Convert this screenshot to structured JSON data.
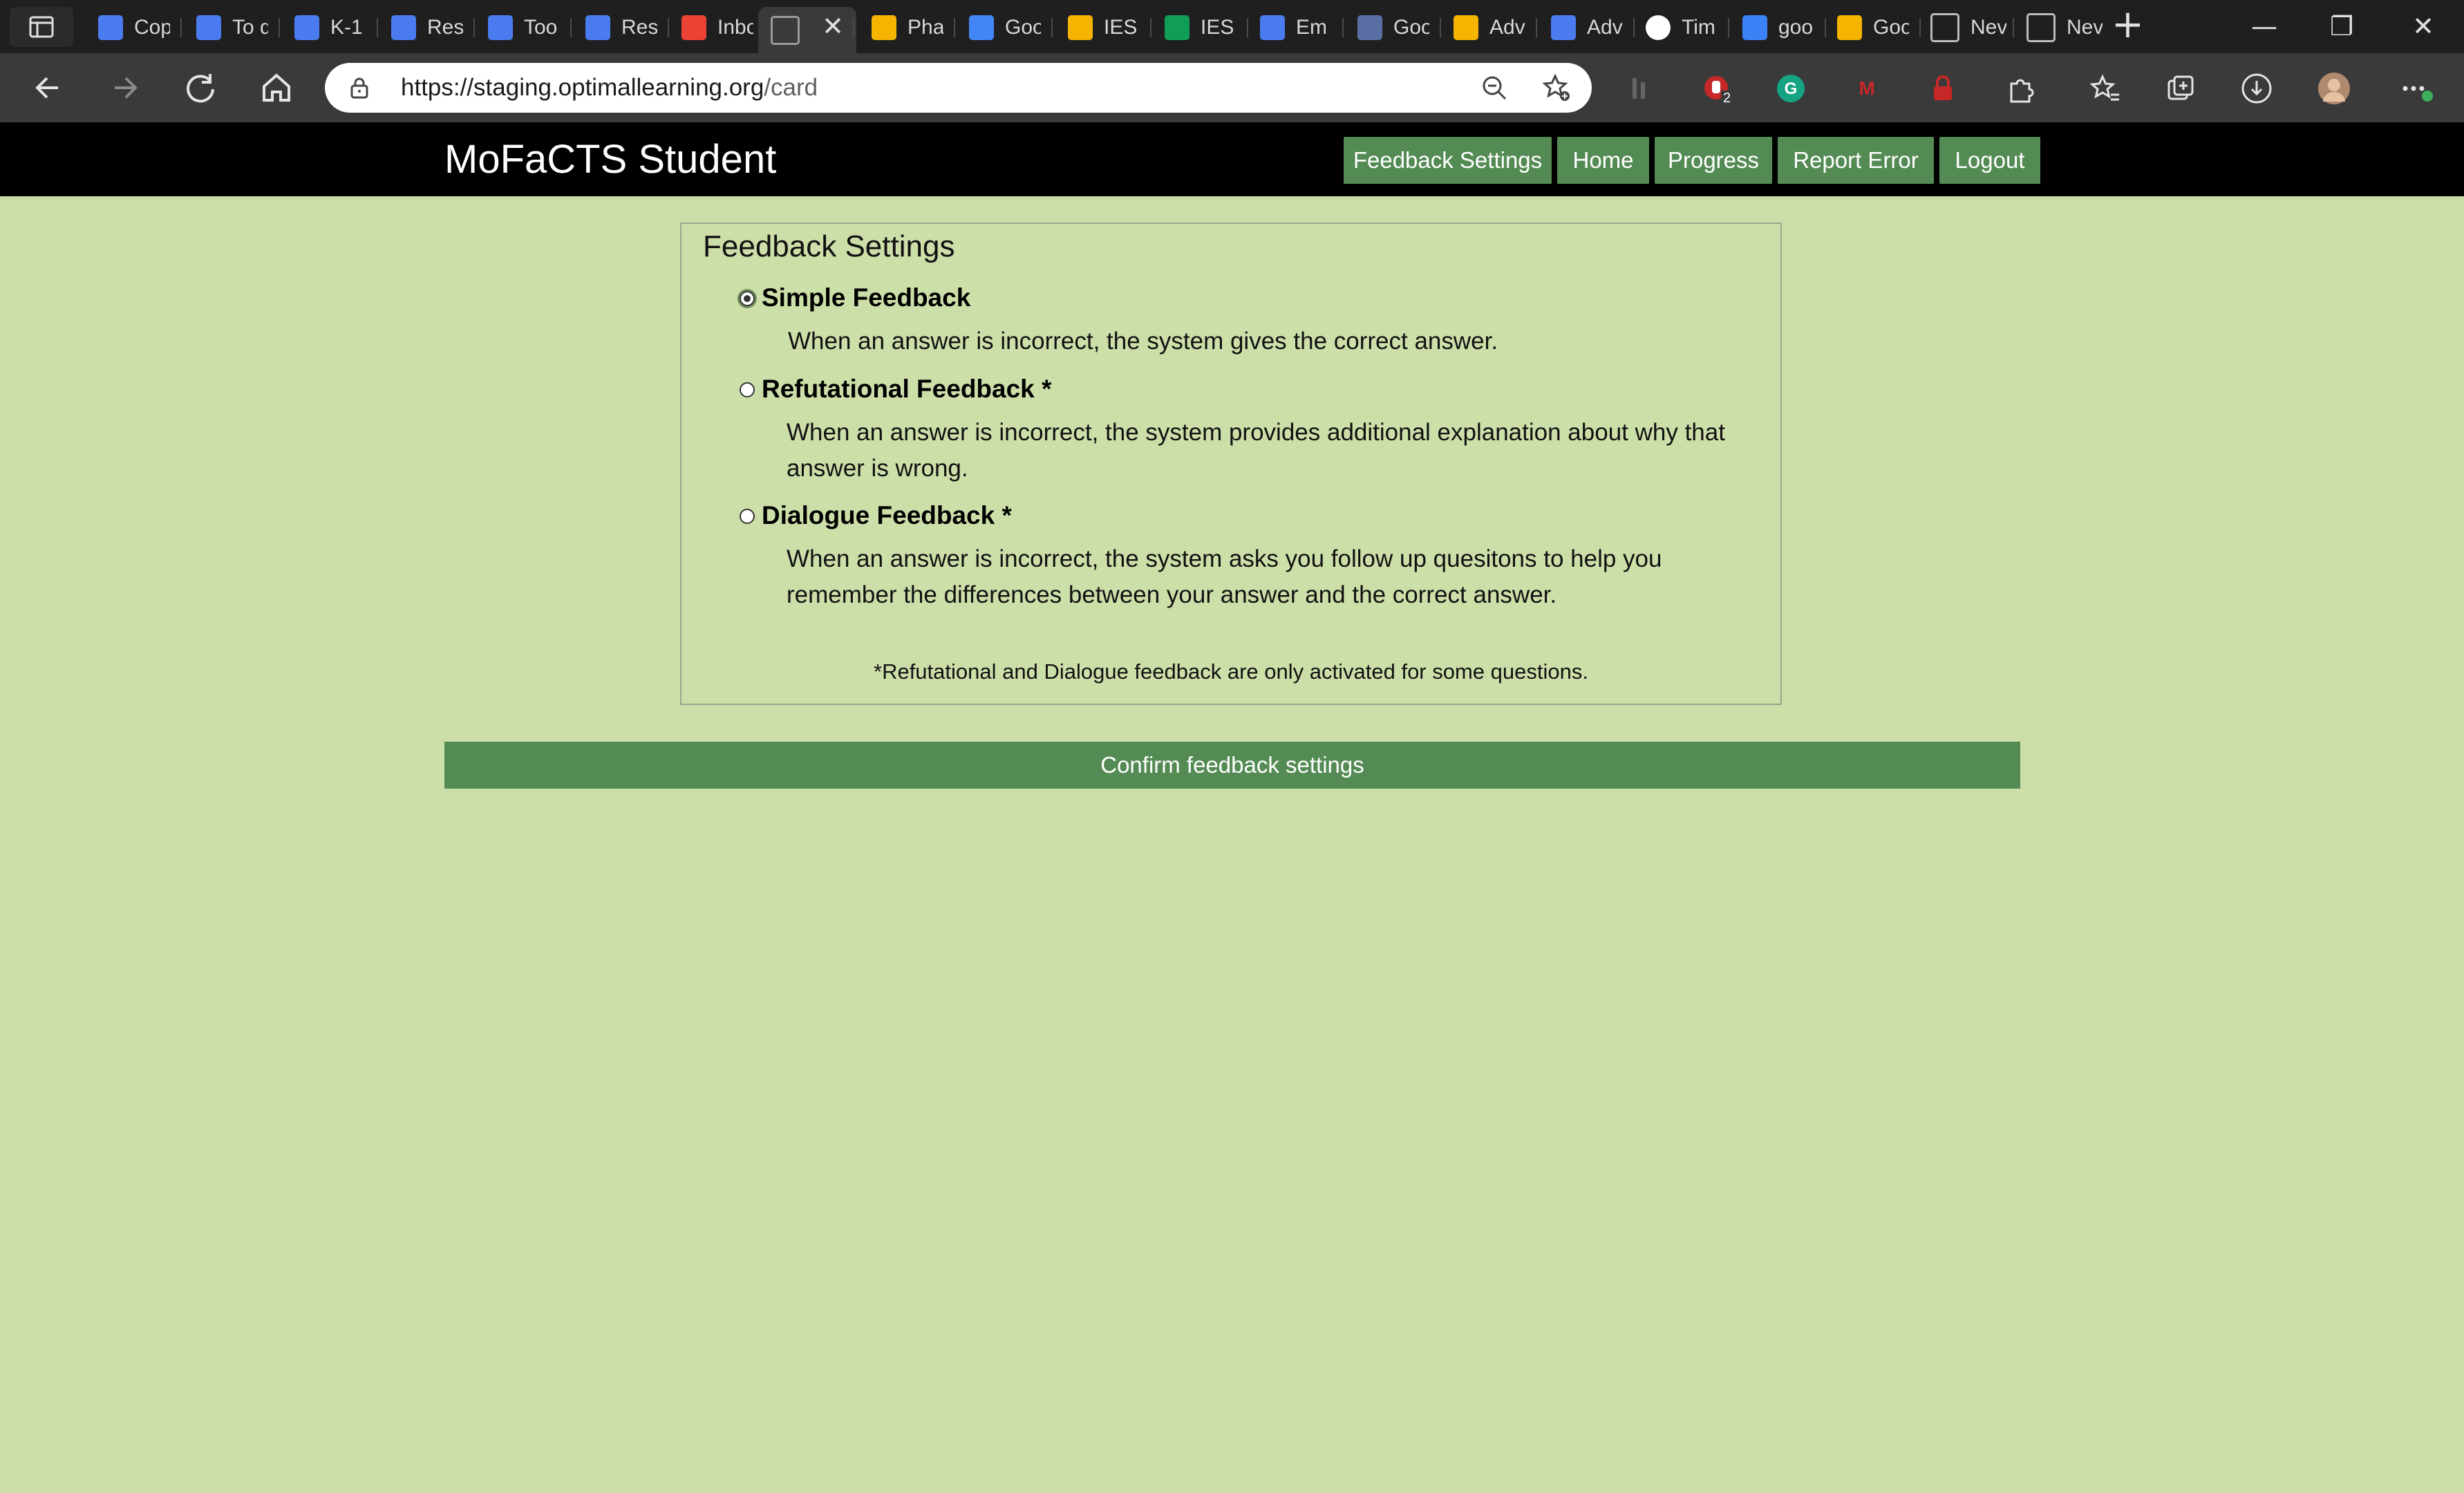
{
  "browser": {
    "tabs": [
      {
        "title": "Cop",
        "icon": "docs-icon",
        "color": "#4a7cf0"
      },
      {
        "title": "To d",
        "icon": "docs-icon",
        "color": "#4a7cf0"
      },
      {
        "title": "K-1",
        "icon": "docs-icon",
        "color": "#4a7cf0"
      },
      {
        "title": "Res",
        "icon": "docs-icon",
        "color": "#4a7cf0"
      },
      {
        "title": "Too",
        "icon": "docs-icon",
        "color": "#4a7cf0"
      },
      {
        "title": "Res",
        "icon": "docs-icon",
        "color": "#4a7cf0"
      },
      {
        "title": "Inbo",
        "icon": "gmail-icon",
        "color": "#ea4335"
      },
      {
        "title": "",
        "icon": "page-icon",
        "color": "#9a9a9a"
      },
      {
        "title": "Pha",
        "icon": "drive-icon",
        "color": "#f4b400"
      },
      {
        "title": "Goo",
        "icon": "calendar-icon",
        "color": "#4285f4"
      },
      {
        "title": "IES",
        "icon": "drive-icon",
        "color": "#f4b400"
      },
      {
        "title": "IES",
        "icon": "sheets-icon",
        "color": "#0f9d58"
      },
      {
        "title": "Em",
        "icon": "docs-icon",
        "color": "#4a7cf0"
      },
      {
        "title": "Goo",
        "icon": "classroom-icon",
        "color": "#5a6fa3"
      },
      {
        "title": "Adv",
        "icon": "drive-icon",
        "color": "#f4b400"
      },
      {
        "title": "Adv",
        "icon": "docs-icon",
        "color": "#4a7cf0"
      },
      {
        "title": "Tim",
        "icon": "github-icon",
        "color": "#ffffff"
      },
      {
        "title": "goo",
        "icon": "bing-icon",
        "color": "#3b82f6"
      },
      {
        "title": "Goo",
        "icon": "slides-icon",
        "color": "#f4b400"
      },
      {
        "title": "Nev",
        "icon": "newtab-icon",
        "color": "#bbbbbb"
      },
      {
        "title": "Nev",
        "icon": "newtab-icon",
        "color": "#bbbbbb"
      }
    ],
    "new_tab_glyph": "+",
    "window_controls": {
      "minimize": "—",
      "restore": "❐",
      "close": "✕"
    },
    "address": {
      "url_host": "https://staging.optimallearning.org",
      "url_path": "/card"
    },
    "extensions": [
      {
        "name": "extension-bars-icon",
        "badge": ""
      },
      {
        "name": "adblock-extension-icon",
        "badge": "2"
      },
      {
        "name": "grammarly-extension-icon",
        "badge": ""
      },
      {
        "name": "mcafee-extension-icon",
        "badge": ""
      },
      {
        "name": "lock-extension-icon",
        "badge": ""
      },
      {
        "name": "extensions-puzzle-icon",
        "badge": ""
      }
    ]
  },
  "navbar": {
    "brand": "MoFaCTS Student",
    "links": [
      "Feedback Settings",
      "Home",
      "Progress",
      "Report Error",
      "Logout"
    ]
  },
  "feedback": {
    "title": "Feedback Settings",
    "options": [
      {
        "label": "Simple Feedback",
        "checked": true,
        "description": "When an answer is incorrect, the system gives the correct answer."
      },
      {
        "label": "Refutational Feedback *",
        "checked": false,
        "description": "When an answer is incorrect, the system provides additional explanation about why that answer is wrong."
      },
      {
        "label": "Dialogue Feedback *",
        "checked": false,
        "description": "When an answer is incorrect, the system asks you follow up quesitons to help you remember the differences between your answer and the correct answer."
      }
    ],
    "footnote": "*Refutational and Dialogue feedback are only activated for some questions.",
    "confirm_label": "Confirm feedback settings"
  },
  "colors": {
    "page_background": "#cddfa9",
    "accent_green": "#548b54",
    "navbar_background": "#000000"
  }
}
